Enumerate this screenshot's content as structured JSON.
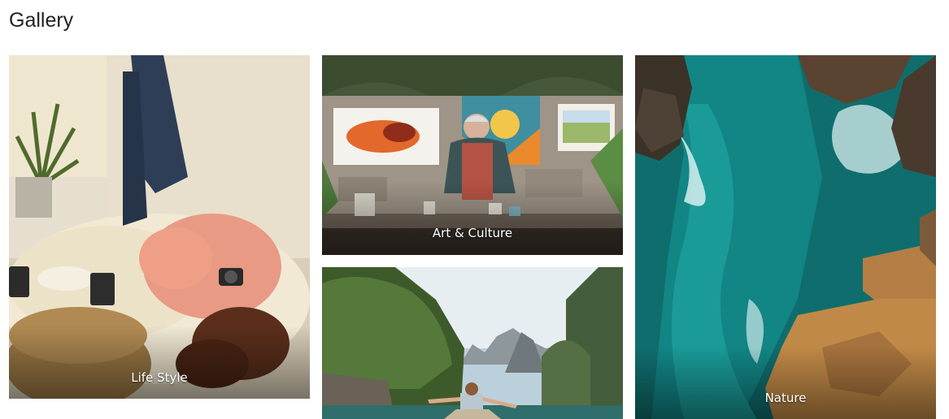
{
  "page": {
    "title": "Gallery"
  },
  "gallery": {
    "items": [
      {
        "label": "Life Style"
      },
      {
        "label": "Art & Culture"
      },
      {
        "label": ""
      },
      {
        "label": "Nature"
      }
    ]
  },
  "colors": {
    "title_text": "#222222",
    "caption_text": "#ffffff",
    "background": "#ffffff"
  }
}
